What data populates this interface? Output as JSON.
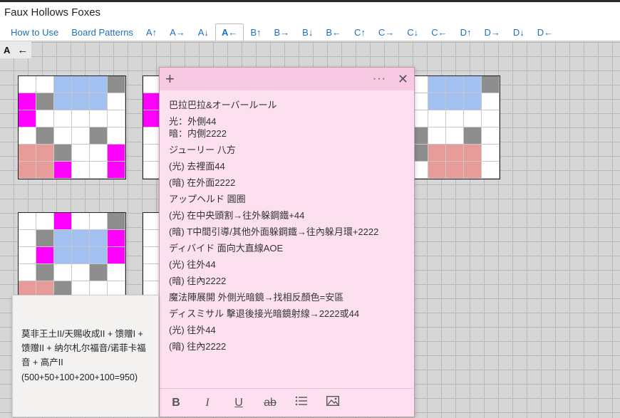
{
  "app": {
    "title": "Faux Hollows Foxes"
  },
  "tabs": [
    {
      "label": "How to Use",
      "active": false
    },
    {
      "label": "Board Patterns",
      "active": false
    },
    {
      "label": "A↑",
      "active": false
    },
    {
      "label": "A→",
      "active": false
    },
    {
      "label": "A↓",
      "active": false
    },
    {
      "label": "A←",
      "active": true
    },
    {
      "label": "B↑",
      "active": false
    },
    {
      "label": "B→",
      "active": false
    },
    {
      "label": "B↓",
      "active": false
    },
    {
      "label": "B←",
      "active": false
    },
    {
      "label": "C↑",
      "active": false
    },
    {
      "label": "C→",
      "active": false
    },
    {
      "label": "C↓",
      "active": false
    },
    {
      "label": "C←",
      "active": false
    },
    {
      "label": "D↑",
      "active": false
    },
    {
      "label": "D→",
      "active": false
    },
    {
      "label": "D↓",
      "active": false
    },
    {
      "label": "D←",
      "active": false
    }
  ],
  "indicator": {
    "letter": "A",
    "arrow": "←"
  },
  "colors": {
    "empty": "#ffffff",
    "blue": "#a3c1f0",
    "gray": "#8e8e8e",
    "magenta": "#ff00ff",
    "pink": "#e89c99"
  },
  "boards": {
    "top_left": [
      "wwbbbg",
      "mgbbbw",
      "mwwwww",
      "wgwwgw",
      "ppgwwm",
      "ppmwwm"
    ],
    "top_right": [
      "wwbbbg",
      "gwbbbw",
      "wwwwww",
      "wgwwgw",
      "wgpppw",
      "wwpppw"
    ],
    "bottom_left": [
      "wwmwwg",
      "wgbbbm",
      "wmbbbm",
      "wgwwgw",
      "ppgwww",
      "ppwwww"
    ]
  },
  "note": {
    "lines": [
      "巴拉巴拉&オーバールール",
      "光：外側44",
      "暗：内側2222",
      "ジューリー 八方",
      "(光) 去裡面44",
      "(暗) 在外面2222",
      "アップヘルド 圓圈",
      "(光) 在中央頭割→往外躲鋼鐵+44",
      "(暗) T中間引導/其他外面躲鋼鐵→往內躲月環+2222",
      "ディバイド 面向大直線AOE",
      "(光) 往外44",
      "(暗) 往內2222",
      "魔法陣展開 外側光暗鏡→找相反顏色=安區",
      "ディスミサル 擊退後接光暗鏡射線→2222或44",
      "(光) 往外44",
      "(暗) 往內2222"
    ],
    "toolbar": {
      "bold": "B",
      "italic": "I",
      "underline": "U",
      "strike": "ab"
    }
  },
  "small_note": {
    "text": "莫非王土II/天赐收成II + 馈赠I + 馈赠II + 纳尔札尔福音/诺菲卡福音 + 高产II",
    "sub": "(500+50+100+200+100=950)"
  }
}
